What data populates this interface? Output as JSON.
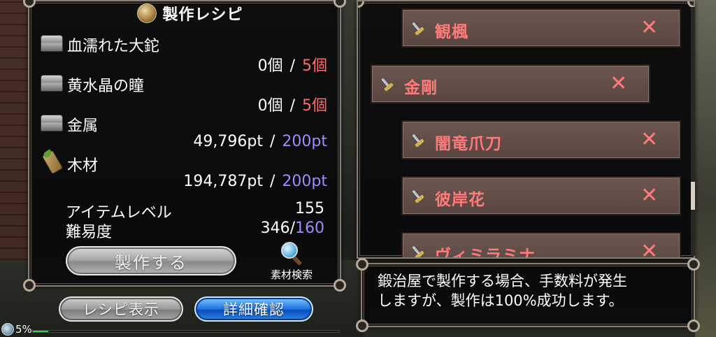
{
  "recipe_panel": {
    "title": "製作レシピ",
    "materials": [
      {
        "name": "血濡れた大鉈",
        "icon": "chest-icon",
        "have": "0個",
        "separator": "/",
        "need": "5個",
        "need_color": "red"
      },
      {
        "name": "黄水晶の瞳",
        "icon": "chest-icon",
        "have": "0個",
        "separator": "/",
        "need": "5個",
        "need_color": "red"
      },
      {
        "name": "金属",
        "icon": "chest-icon",
        "have": "49,796pt",
        "separator": "/",
        "need": "200pt",
        "need_color": "blue"
      },
      {
        "name": "木材",
        "icon": "wood-icon",
        "have": "194,787pt",
        "separator": "/",
        "need": "200pt",
        "need_color": "blue"
      }
    ],
    "item_level_label": "アイテムレベル",
    "item_level_value": "155",
    "difficulty_label": "難易度",
    "difficulty_value": "346/",
    "difficulty_max": "160",
    "craft_button": "製作する",
    "search_label": "素材検索"
  },
  "bottom_buttons": {
    "recipe_show": "レシピ表示",
    "details": "詳細確認"
  },
  "status": {
    "percent_text": "5%",
    "progress": 0.05
  },
  "recipe_list": [
    {
      "name": "観楓",
      "x_glyph": "✕"
    },
    {
      "name": "金剛",
      "x_glyph": "✕"
    },
    {
      "name": "闇竜爪刀",
      "x_glyph": "✕"
    },
    {
      "name": "彼岸花",
      "x_glyph": "✕"
    },
    {
      "name": "ヴィミラミナ",
      "x_glyph": "✕"
    }
  ],
  "message": "鍛治屋で製作する場合、手数料が発生\nしますが、製作は100%成功します。",
  "colors": {
    "need_red": "#ff6b6b",
    "need_blue": "#9b8cff",
    "item_text": "#ff7a7a",
    "progress_green": "#3fd04a"
  }
}
